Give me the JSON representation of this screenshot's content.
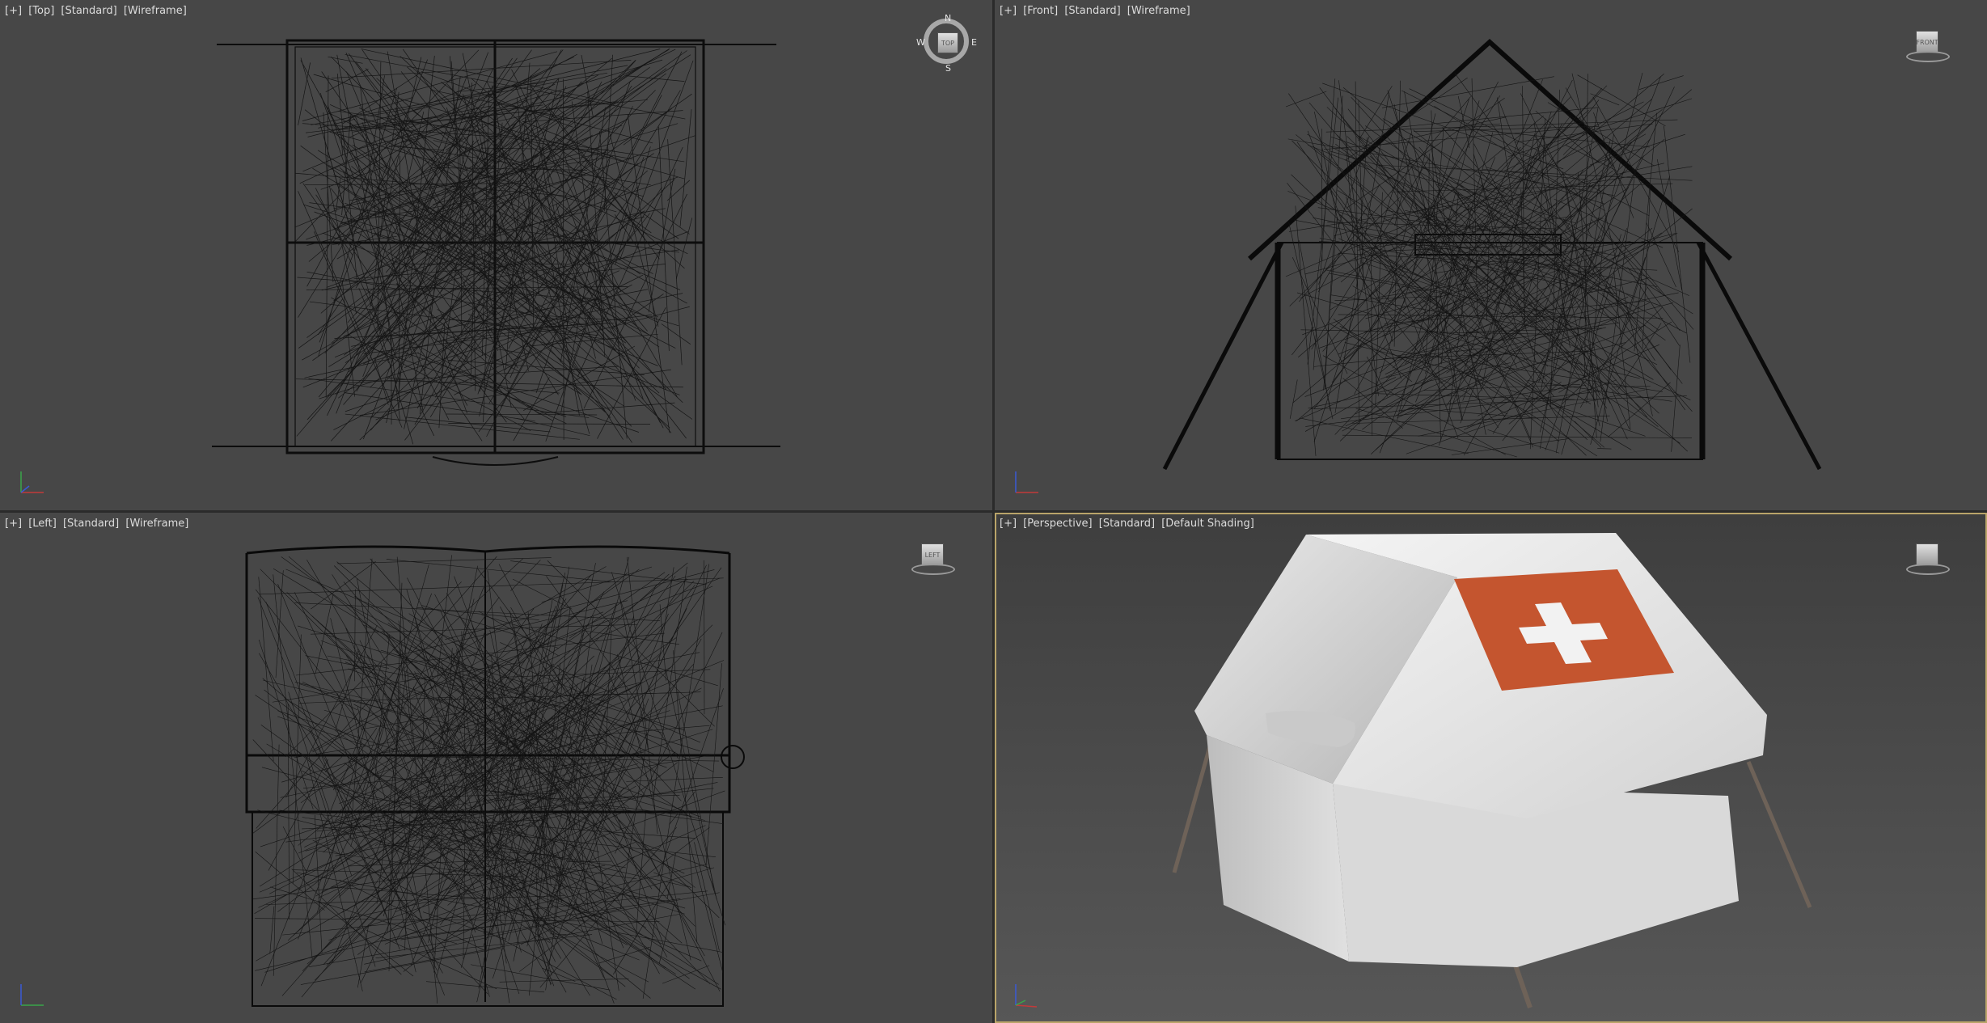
{
  "viewports": {
    "top": {
      "tags": [
        "[+]",
        "[Top]",
        "[Standard]",
        "[Wireframe]"
      ],
      "viewcube_label": "TOP",
      "compass": {
        "n": "N",
        "s": "S",
        "e": "E",
        "w": "W"
      }
    },
    "front": {
      "tags": [
        "[+]",
        "[Front]",
        "[Standard]",
        "[Wireframe]"
      ],
      "viewcube_label": "FRONT"
    },
    "left": {
      "tags": [
        "[+]",
        "[Left]",
        "[Standard]",
        "[Wireframe]"
      ],
      "viewcube_label": "LEFT"
    },
    "perspective": {
      "tags": [
        "[+]",
        "[Perspective]",
        "[Standard]",
        "[Default Shading]"
      ],
      "viewcube_label": ""
    }
  },
  "colors": {
    "viewport_bg": "#474747",
    "active_border": "#b9a469",
    "wire": "#0a0a0a",
    "cross_red": "#c4552f",
    "tent_white": "#e8e8e8"
  }
}
